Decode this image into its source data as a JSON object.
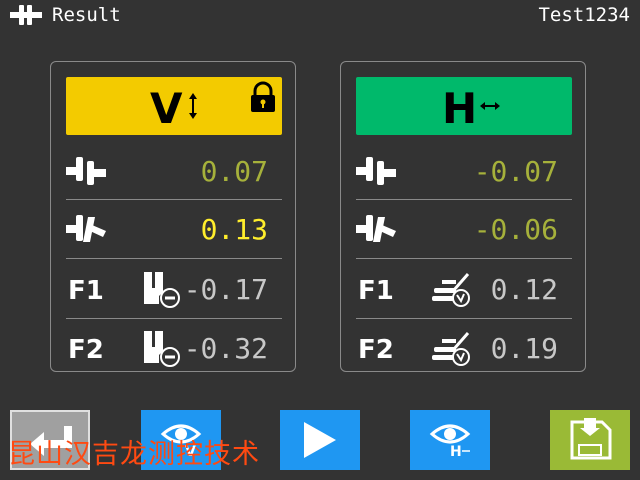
{
  "header": {
    "title": "Result",
    "user": "Test1234",
    "logo_icon": "measure-jaws-icon"
  },
  "panel_v": {
    "heading": "V",
    "heading_icon": "vertical-arrow-icon",
    "lock_icon": "lock-icon",
    "color": "#f3cb00",
    "rows": [
      {
        "icon": "coupling-parallel-icon",
        "value": "0.07",
        "color": "#a6b13b"
      },
      {
        "icon": "coupling-angular-icon",
        "value": "0.13",
        "color": "#ffee2c"
      },
      {
        "label": "F1",
        "icon": "shim-remove-icon",
        "value": "-0.17",
        "color": "#c8c8c8"
      },
      {
        "label": "F2",
        "icon": "shim-remove-icon",
        "value": "-0.32",
        "color": "#c8c8c8"
      }
    ]
  },
  "panel_h": {
    "heading": "H",
    "heading_icon": "horizontal-arrow-icon",
    "color": "#00b96b",
    "rows": [
      {
        "icon": "coupling-parallel-icon",
        "value": "-0.07",
        "color": "#a6b13b"
      },
      {
        "icon": "coupling-angular-icon",
        "value": "-0.06",
        "color": "#a6b13b"
      },
      {
        "label": "F1",
        "icon": "foot-adjust-icon",
        "value": "0.12",
        "color": "#c8c8c8"
      },
      {
        "label": "F2",
        "icon": "foot-adjust-icon",
        "value": "0.19",
        "color": "#c8c8c8"
      }
    ]
  },
  "toolbar": {
    "back": "back-icon",
    "view_v": "eye-v-icon",
    "play": "play-icon",
    "view_h": "eye-h-icon",
    "save": "save-icon"
  },
  "watermark": "昆山汉吉龙测控技术"
}
